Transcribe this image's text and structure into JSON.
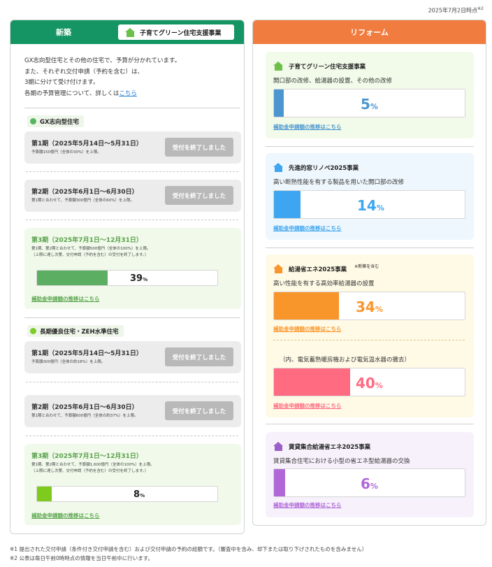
{
  "date_note": {
    "text": "2025年7月2日時点",
    "sup": "※2"
  },
  "left": {
    "header_title": "新築",
    "badge_label": "子育てグリーン住宅支援事業",
    "intro": {
      "line1": "GX志向型住宅とその他の住宅で、予算が分かれています。",
      "line2": "また、それぞれ交付申請（予約を含む）は、",
      "line3": "3期に分けて受け付けます。",
      "line4_prefix": "各期の予算管理について、詳しくは",
      "line4_link": "こちら"
    },
    "gx": {
      "label": "GX志向型住宅",
      "p1": {
        "title": "第1期（2025年5月14日〜5月31日）",
        "note": "予算額150億円（全体の30%）を上限。",
        "status": "受付を終了しました"
      },
      "p2": {
        "title": "第2期（2025年6月1日〜6月30日）",
        "note": "第1期と合わせて、予算額300億円（全体の60%）を上限。",
        "status": "受付を終了しました"
      },
      "p3": {
        "title": "第3期（2025年7月1日〜12月31日）",
        "note1": "第1期、第2期と合わせて、予算額500億円（全体の100%）を上限。",
        "note2": "（上限に達し次第、交付申請（予約を含む）の受付を終了します。）",
        "percent": "39",
        "unit": "%",
        "value": 39,
        "link": "補助金申請額の推移はこちら"
      }
    },
    "zeh": {
      "label": "長期優良住宅・ZEH水準住宅",
      "p1": {
        "title": "第1期（2025年5月14日〜5月31日）",
        "note": "予算額300億円（全体の約18%）を上限。",
        "status": "受付を終了しました"
      },
      "p2": {
        "title": "第2期（2025年6月1日〜6月30日）",
        "note": "第1期と合わせて、予算額600億円（全体の約37%）を上限。",
        "status": "受付を終了しました"
      },
      "p3": {
        "title": "第3期（2025年7月1日〜12月31日）",
        "note1": "第1期、第2期と合わせて、予算額1,600億円（全体の100%）を上限。",
        "note2": "（上限に達し次第、交付申請（予約を含む）の受付を終了します。）",
        "percent": "8",
        "unit": "%",
        "value": 8,
        "link": "補助金申請額の推移はこちら"
      }
    }
  },
  "right": {
    "header_title": "リフォーム",
    "c1": {
      "title": "子育てグリーン住宅支援事業",
      "desc": "開口部の改修、給湯器の設置、その他の改修",
      "percent": "5",
      "unit": "%",
      "value": 5,
      "link": "補助金申請額の推移はこちら",
      "color": "#4b96d0"
    },
    "c2": {
      "title": "先進的窓リノベ2025事業",
      "desc": "高い断熱性能を有する製品を用いた開口部の改修",
      "percent": "14",
      "unit": "%",
      "value": 14,
      "link": "補助金申請額の推移はこちら",
      "color": "#3ea6f0"
    },
    "c3": {
      "title": "給湯省エネ2025事業",
      "title_note": "※新築を含む",
      "desc": "高い性能を有する高効率給湯器の設置",
      "percent": "34",
      "unit": "%",
      "value": 34,
      "link": "補助金申請額の推移はこちら",
      "color": "#f9962b",
      "sub_desc": "（内、電気蓄熱暖房機および電気温水器の撤去）",
      "sub_percent": "40",
      "sub_value": 40,
      "sub_link": "補助金申請額の推移はこちら",
      "sub_color": "#ff6b81"
    },
    "c4": {
      "title": "賃貸集合給湯省エネ2025事業",
      "desc": "賃貸集合住宅における小型の省エネ型給湯器の交換",
      "percent": "6",
      "unit": "%",
      "value": 6,
      "link": "補助金申請額の推移はこちら",
      "color": "#b068d8"
    }
  },
  "footnotes": {
    "n1": "※1 提出された交付申請（条件付き交付申請を含む）および交付申請の予約の総額です。（審査中を含み、却下または取り下げされたものを含みません）",
    "n2": "※2 公表は毎日午前0時時点の情報を当日午前中に行います。"
  }
}
